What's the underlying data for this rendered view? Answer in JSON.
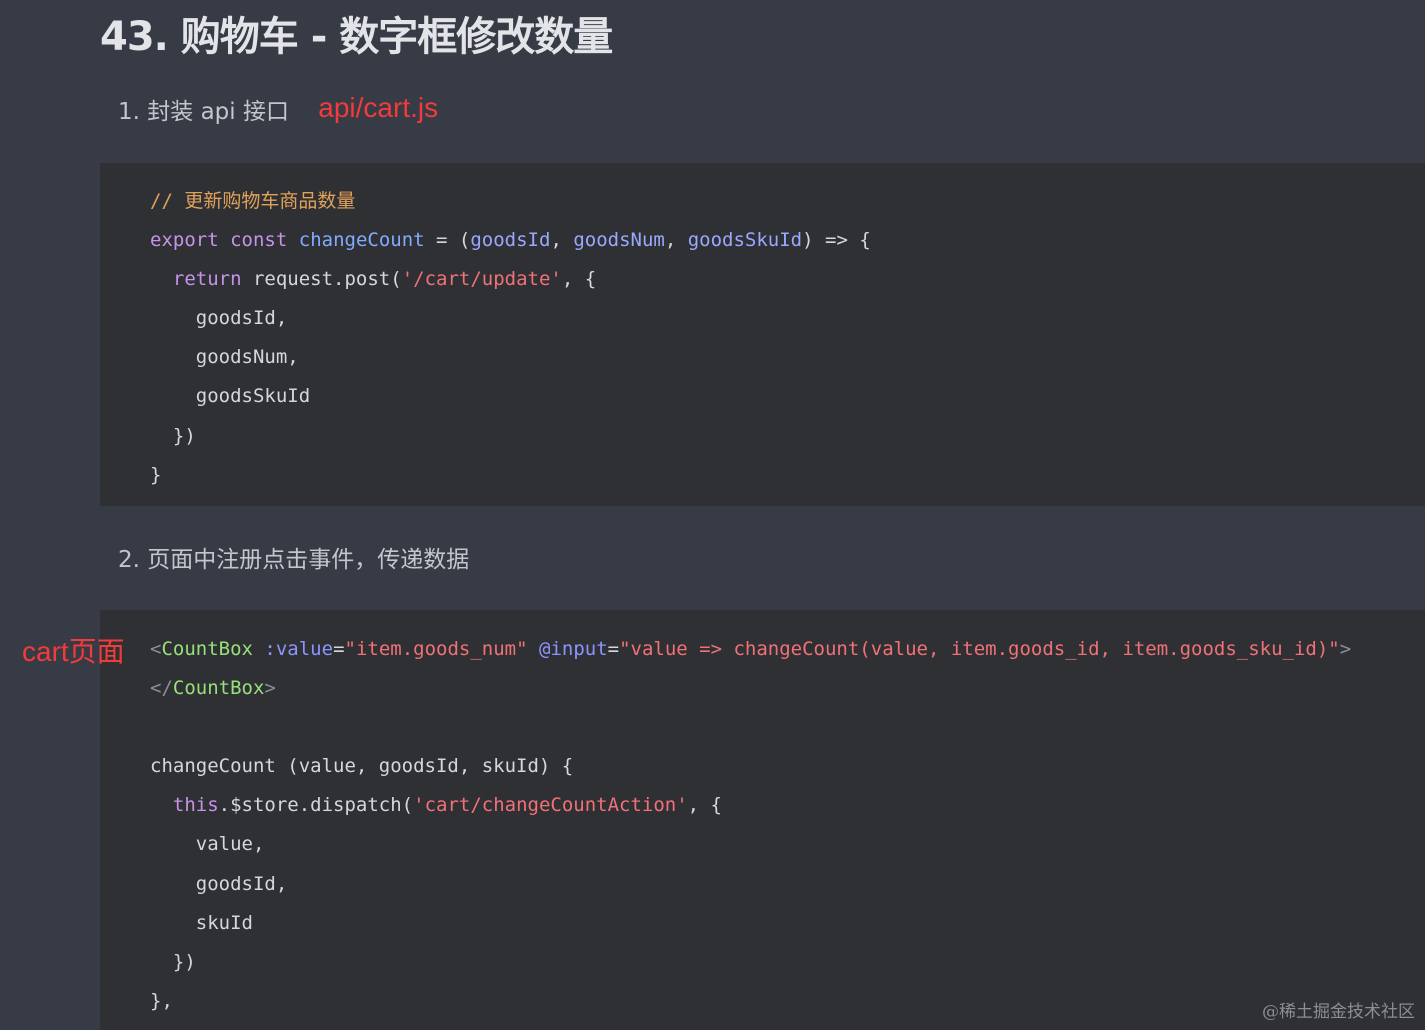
{
  "heading": "43. 购物车 - 数字框修改数量",
  "step1": {
    "label": "1. 封装 api 接口",
    "annotation": "api/cart.js"
  },
  "step2": {
    "label": "2. 页面中注册点击事件，传递数据",
    "annotation": "cart页面"
  },
  "code1": {
    "comment": "// 更新购物车商品数量",
    "export_kw": "export",
    "const_kw": "const",
    "fn_name": "changeCount",
    "assign": " = (",
    "param1": "goodsId",
    "param2": "goodsNum",
    "param3": "goodsSkuId",
    "sep": ", ",
    "arrow": ") => {",
    "return_kw": "return",
    "call": " request.post(",
    "url": "'/cart/update'",
    "call_end": ", {",
    "field1": "goodsId,",
    "field2": "goodsNum,",
    "field3": "goodsSkuId",
    "close_obj": "})",
    "close_fn": "}"
  },
  "code2": {
    "lt": "<",
    "tag_name": "CountBox",
    "attr1": ":value",
    "eq": "=",
    "val1": "\"item.goods_num\"",
    "attr2": "@input",
    "val2": "\"value => changeCount(value, item.goods_id, item.goods_sku_id)\"",
    "gt": ">",
    "close_lt": "</",
    "method_sig": "changeCount (value, goodsId, skuId) {",
    "this_kw": "this",
    "dispatch": ".$store.dispatch(",
    "action": "'cart/changeCountAction'",
    "dispatch_end": ", {",
    "field1": "value,",
    "field2": "goodsId,",
    "field3": "skuId",
    "close_obj": "})",
    "close_method": "},"
  },
  "watermark": "@稀土掘金技术社区"
}
